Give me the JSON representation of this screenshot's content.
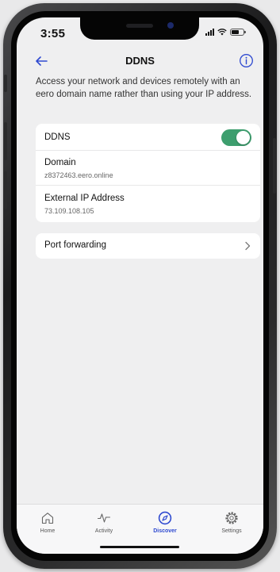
{
  "status_bar": {
    "time": "3:55"
  },
  "header": {
    "title": "DDNS",
    "back_icon": "arrow-left-icon",
    "info_icon": "info-icon"
  },
  "intro": "Access your network and devices remotely with an eero domain name rather than using your IP address.",
  "settings": {
    "ddns": {
      "label": "DDNS",
      "enabled": true
    },
    "domain": {
      "label": "Domain",
      "value": "z8372463.eero.online"
    },
    "external_ip": {
      "label": "External IP Address",
      "value": "73.109.108.105"
    }
  },
  "port_forwarding": {
    "label": "Port forwarding"
  },
  "tabs": [
    {
      "label": "Home",
      "icon": "home-icon"
    },
    {
      "label": "Activity",
      "icon": "pulse-icon"
    },
    {
      "label": "Discover",
      "icon": "compass-icon",
      "active": true
    },
    {
      "label": "Settings",
      "icon": "gear-icon"
    }
  ],
  "colors": {
    "accent": "#2f4ad0",
    "toggle_on": "#3d9e6e",
    "background": "#efeff0"
  }
}
